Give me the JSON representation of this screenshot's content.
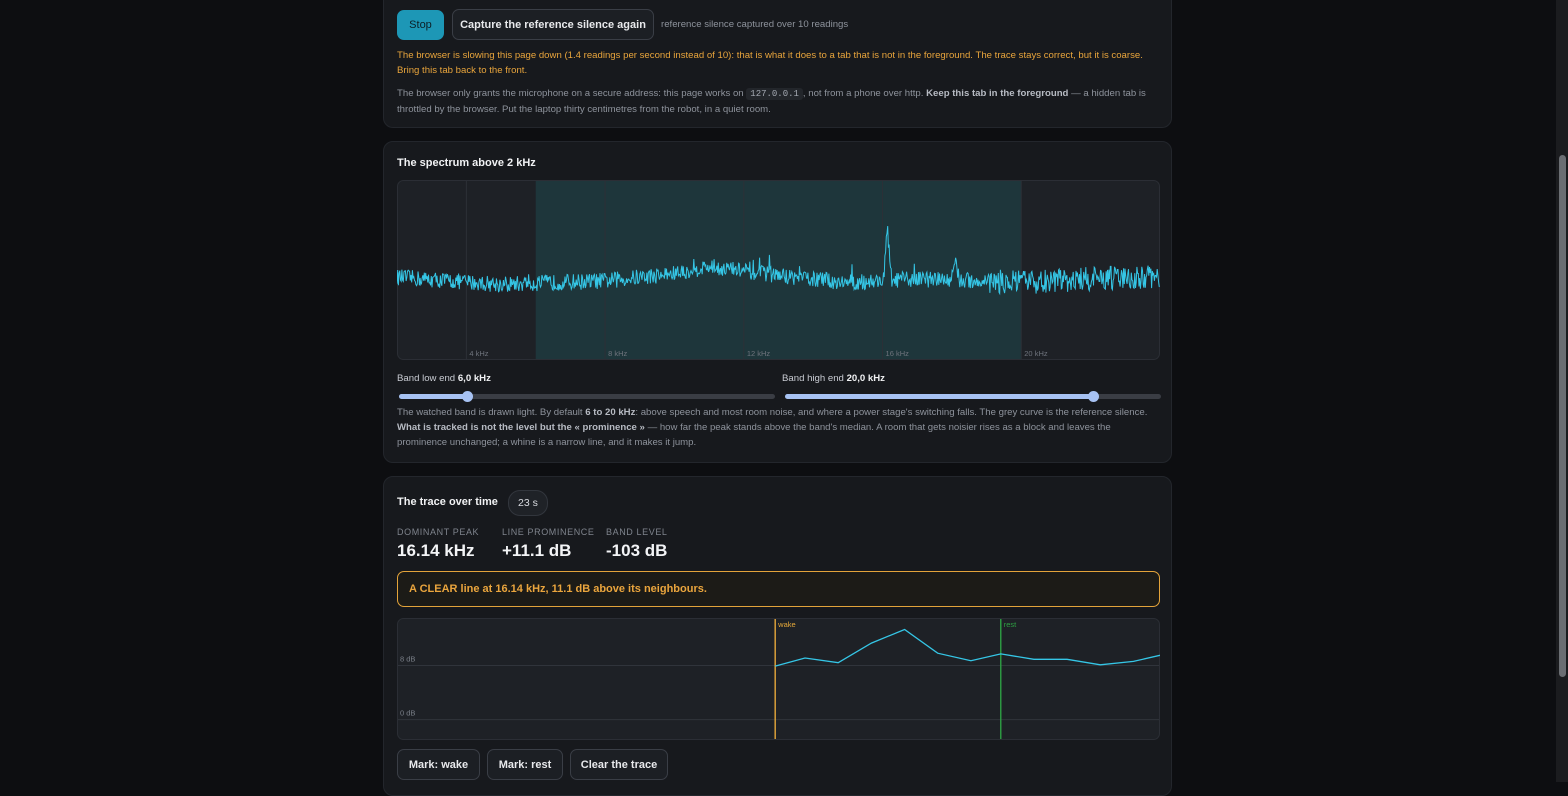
{
  "controls": {
    "stop_label": "Stop",
    "capture_label": "Capture the reference silence again",
    "reference_status": "reference silence captured over 10 readings",
    "throttle_warning": "The browser is slowing this page down (1.4 readings per second instead of 10): that is what it does to a tab that is not in the foreground. The trace stays correct, but it is coarse. Bring this tab back to the front.",
    "note_part1": "The browser only grants the microphone on a secure address: this page works on ",
    "note_code": "127.0.0.1",
    "note_part2": ", not from a phone over http. ",
    "note_bold": "Keep this tab in the foreground",
    "note_part3": " — a hidden tab is throttled by the browser. Put the laptop thirty centimetres from the robot, in a quiet room."
  },
  "spectrum": {
    "title": "The spectrum above 2 kHz",
    "band_low_label": "Band low end ",
    "band_low_value": "6,0 kHz",
    "band_low_khz": 6.0,
    "band_high_label": "Band high end ",
    "band_high_value": "20,0 kHz",
    "band_high_khz": 20.0,
    "desc_part1": "The watched band is drawn light. By default ",
    "desc_bold1": "6 to 20 kHz",
    "desc_part2": ": above speech and most room noise, and where a power stage's switching falls. The grey curve is the reference silence. ",
    "desc_bold2": "What is tracked is not the level but the « prominence »",
    "desc_part3": " — how far the peak stands above the band's median. A room that gets noisier rises as a block and leaves the prominence unchanged; a whine is a narrow line, and it makes it jump.",
    "chart_data": {
      "type": "line",
      "x_range_khz": [
        2,
        24
      ],
      "ticks": [
        {
          "khz": 4,
          "label": "4 kHz"
        },
        {
          "khz": 8,
          "label": "8 kHz"
        },
        {
          "khz": 12,
          "label": "12 kHz"
        },
        {
          "khz": 16,
          "label": "16 kHz"
        },
        {
          "khz": 20,
          "label": "20 kHz"
        }
      ],
      "highlighted_band_khz": [
        6,
        20
      ],
      "series_color": "#35c6e6",
      "peaks_khz": [
        {
          "khz": 16.14,
          "strength": 1.0
        },
        {
          "khz": 18.1,
          "strength": 0.45
        }
      ],
      "noise_floor_profile": [
        {
          "khz": 2,
          "level": 0.46
        },
        {
          "khz": 5,
          "level": 0.42
        },
        {
          "khz": 8,
          "level": 0.44
        },
        {
          "khz": 10,
          "level": 0.48
        },
        {
          "khz": 11,
          "level": 0.52
        },
        {
          "khz": 13,
          "level": 0.47
        },
        {
          "khz": 15,
          "level": 0.43
        },
        {
          "khz": 17,
          "level": 0.45
        },
        {
          "khz": 20,
          "level": 0.43
        },
        {
          "khz": 22,
          "level": 0.45
        },
        {
          "khz": 24,
          "level": 0.46
        }
      ]
    }
  },
  "trace": {
    "title": "The trace over time",
    "duration_badge": "23 s",
    "stats": [
      {
        "label": "DOMINANT PEAK",
        "value": "16.14 kHz"
      },
      {
        "label": "LINE PROMINENCE",
        "value": "+11.1 dB"
      },
      {
        "label": "BAND LEVEL",
        "value": "-103 dB"
      }
    ],
    "alert": "A CLEAR line at 16.14 kHz, 11.1 dB above its neighbours.",
    "mark_wake_label": "Mark: wake",
    "mark_rest_label": "Mark: rest",
    "clear_label": "Clear the trace",
    "chart_data": {
      "type": "line",
      "t_range_s": [
        0,
        23
      ],
      "y_range_db": [
        -3,
        15
      ],
      "gridlines": [
        {
          "db": 8,
          "label": "8 dB"
        },
        {
          "db": 0,
          "label": "0 dB"
        }
      ],
      "markers": [
        {
          "t": 11.4,
          "label": "wake",
          "color": "#e6a93a"
        },
        {
          "t": 18.2,
          "label": "rest",
          "color": "#2ea043"
        }
      ],
      "series_color": "#35c6e6",
      "points": [
        {
          "t": 11.4,
          "db": 7.9
        },
        {
          "t": 12.3,
          "db": 9.1
        },
        {
          "t": 13.3,
          "db": 8.4
        },
        {
          "t": 14.3,
          "db": 11.3
        },
        {
          "t": 15.3,
          "db": 13.3
        },
        {
          "t": 16.3,
          "db": 9.8
        },
        {
          "t": 17.3,
          "db": 8.7
        },
        {
          "t": 18.2,
          "db": 9.7
        },
        {
          "t": 19.2,
          "db": 8.9
        },
        {
          "t": 20.2,
          "db": 8.9
        },
        {
          "t": 21.2,
          "db": 8.1
        },
        {
          "t": 22.2,
          "db": 8.6
        },
        {
          "t": 23.0,
          "db": 9.5
        }
      ]
    }
  }
}
